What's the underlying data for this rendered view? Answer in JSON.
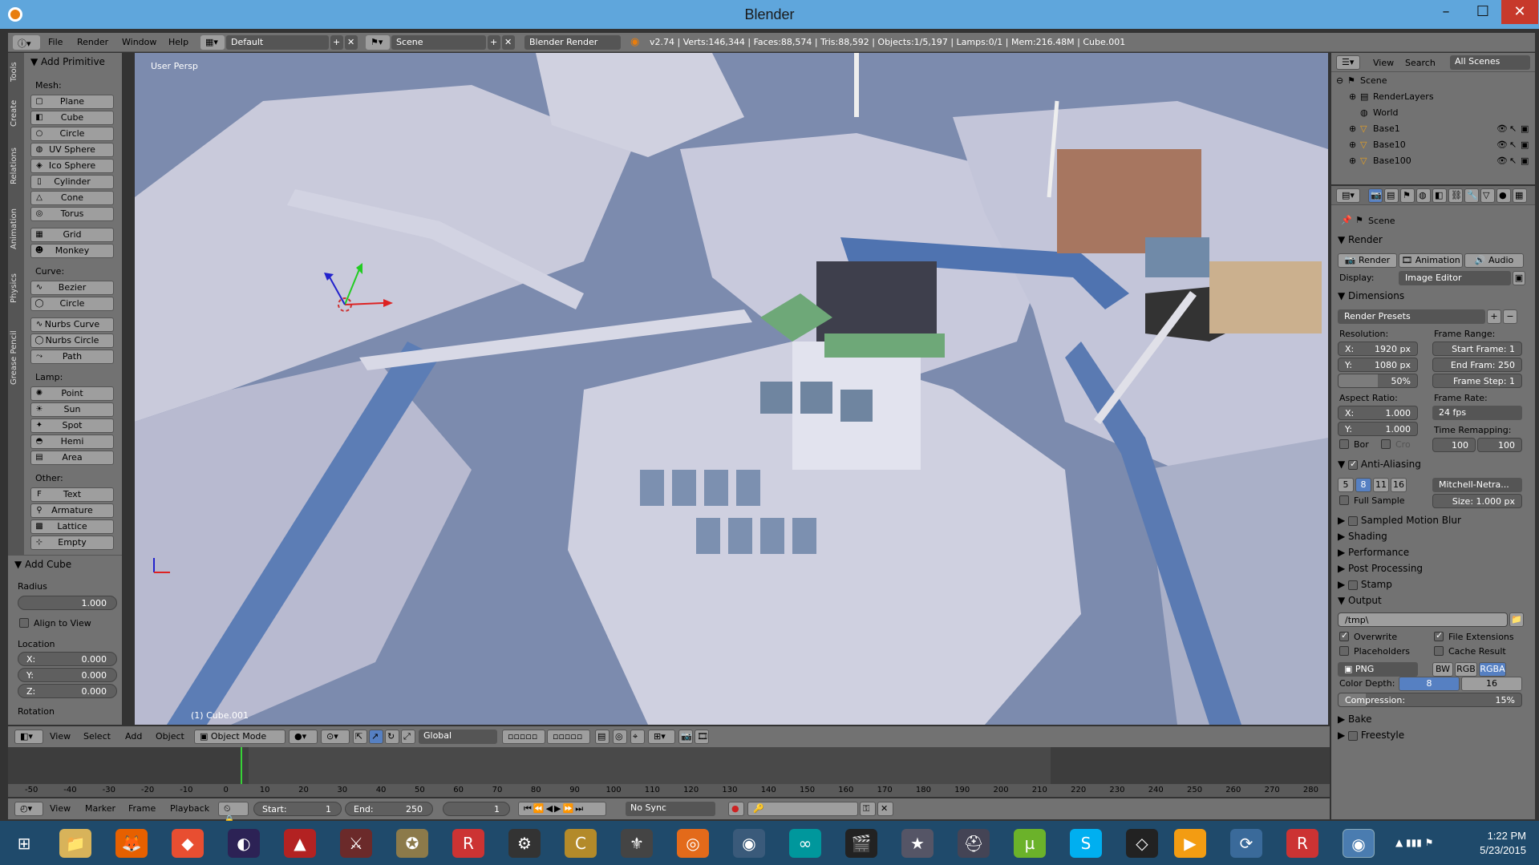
{
  "window": {
    "title": "Blender"
  },
  "info": {
    "menus": [
      "File",
      "Render",
      "Window",
      "Help"
    ],
    "layout": "Default",
    "scene": "Scene",
    "engine": "Blender Render",
    "stats": "v2.74 | Verts:146,344 | Faces:88,574 | Tris:88,592 | Objects:1/5,197 | Lamps:0/1 | Mem:216.48M | Cube.001"
  },
  "tools": {
    "tabs": [
      "Tools",
      "Create",
      "Relations",
      "Animation",
      "Physics",
      "Grease Pencil"
    ],
    "panel_title": "Add Primitive",
    "mesh_label": "Mesh:",
    "mesh": [
      "Plane",
      "Cube",
      "Circle",
      "UV Sphere",
      "Ico Sphere",
      "Cylinder",
      "Cone",
      "Torus"
    ],
    "mesh2": [
      "Grid",
      "Monkey"
    ],
    "curve_label": "Curve:",
    "curve": [
      "Bezier",
      "Circle"
    ],
    "curve2": [
      "Nurbs Curve",
      "Nurbs Circle",
      "Path"
    ],
    "lamp_label": "Lamp:",
    "lamp": [
      "Point",
      "Sun",
      "Spot",
      "Hemi",
      "Area"
    ],
    "other_label": "Other:",
    "other": [
      "Text",
      "Armature",
      "Lattice",
      "Empty"
    ]
  },
  "operator": {
    "title": "Add Cube",
    "radius_label": "Radius",
    "radius": "1.000",
    "align": "Align to View",
    "location_label": "Location",
    "x": "0.000",
    "y": "0.000",
    "z": "0.000",
    "rotation_label": "Rotation"
  },
  "viewport": {
    "label": "User Persp",
    "object": "(1) Cube.001",
    "menus": [
      "View",
      "Select",
      "Add",
      "Object"
    ],
    "mode": "Object Mode",
    "orientation": "Global"
  },
  "timeline": {
    "ticks": [
      "-50",
      "-40",
      "-30",
      "-20",
      "-10",
      "0",
      "10",
      "20",
      "30",
      "40",
      "50",
      "60",
      "70",
      "80",
      "90",
      "100",
      "110",
      "120",
      "130",
      "140",
      "150",
      "160",
      "170",
      "180",
      "190",
      "200",
      "210",
      "220",
      "230",
      "240",
      "250",
      "260",
      "270",
      "280"
    ],
    "menus": [
      "View",
      "Marker",
      "Frame",
      "Playback"
    ],
    "start_label": "Start:",
    "start": "1",
    "end_label": "End:",
    "end": "250",
    "current": "1",
    "sync": "No Sync"
  },
  "outliner": {
    "menus": [
      "View",
      "Search"
    ],
    "filter": "All Scenes",
    "items": [
      "Scene",
      "RenderLayers",
      "World",
      "Base1",
      "Base10",
      "Base100"
    ]
  },
  "properties": {
    "context": "Scene",
    "render_head": "Render",
    "render_btns": [
      "Render",
      "Animation",
      "Audio"
    ],
    "display_label": "Display:",
    "display": "Image Editor",
    "dimensions_head": "Dimensions",
    "presets": "Render Presets",
    "resolution_label": "Resolution:",
    "res_x_label": "X:",
    "res_x": "1920 px",
    "res_y_label": "Y:",
    "res_y": "1080 px",
    "res_pct": "50%",
    "frame_range_label": "Frame Range:",
    "start_frame": "Start Frame: 1",
    "end_frame": "End Fram: 250",
    "frame_step": "Frame Step: 1",
    "aspect_label": "Aspect Ratio:",
    "asp_x": "1.000",
    "asp_y": "1.000",
    "frame_rate_label": "Frame Rate:",
    "fps": "24 fps",
    "remap_label": "Time Remapping:",
    "remap_old": "100",
    "remap_new": "100",
    "bor": "Bor",
    "cro": "Cro",
    "aa_head": "Anti-Aliasing",
    "aa_samples": [
      "5",
      "8",
      "11",
      "16"
    ],
    "aa_filter": "Mitchell-Netra...",
    "full_sample": "Full Sample",
    "aa_size": "Size: 1.000 px",
    "collapsed": [
      "Sampled Motion Blur",
      "Shading",
      "Performance",
      "Post Processing",
      "Stamp"
    ],
    "output_head": "Output",
    "output_path": "/tmp\\",
    "overwrite": "Overwrite",
    "file_ext": "File Extensions",
    "placeholders": "Placeholders",
    "cache": "Cache Result",
    "format": "PNG",
    "color_modes": [
      "BW",
      "RGB",
      "RGBA"
    ],
    "depth_label": "Color Depth:",
    "depths": [
      "8",
      "16"
    ],
    "compression": "Compression:",
    "compression_val": "15%",
    "bake": "Bake",
    "freestyle": "Freestyle"
  },
  "taskbar": {
    "time": "1:22 PM",
    "date": "5/23/2015"
  }
}
